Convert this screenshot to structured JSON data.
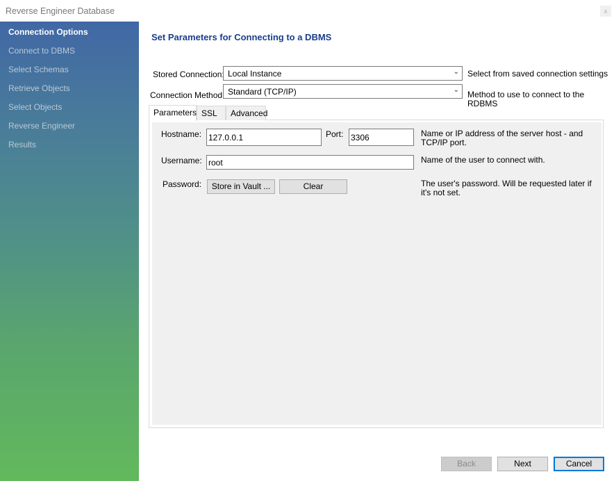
{
  "window": {
    "title": "Reverse Engineer Database",
    "close": "x"
  },
  "sidebar": {
    "items": [
      {
        "label": "Connection Options",
        "active": true
      },
      {
        "label": "Connect to DBMS"
      },
      {
        "label": "Select Schemas"
      },
      {
        "label": "Retrieve Objects"
      },
      {
        "label": "Select Objects"
      },
      {
        "label": "Reverse Engineer"
      },
      {
        "label": "Results"
      }
    ]
  },
  "main": {
    "heading": "Set Parameters for Connecting to a DBMS",
    "stored_connection": {
      "label": "Stored Connection:",
      "value": "Local Instance",
      "desc": "Select from saved connection settings"
    },
    "connection_method": {
      "label": "Connection Method:",
      "value": "Standard (TCP/IP)",
      "desc": "Method to use to connect to the RDBMS"
    },
    "tabs": [
      "Parameters",
      "SSL",
      "Advanced"
    ],
    "params": {
      "hostname_label": "Hostname:",
      "hostname": "127.0.0.1",
      "port_label": "Port:",
      "port": "3306",
      "hostname_desc": "Name or IP address of the server host - and TCP/IP port.",
      "username_label": "Username:",
      "username": "root",
      "username_desc": "Name of the user to connect with.",
      "password_label": "Password:",
      "store_vault": "Store in Vault ...",
      "clear": "Clear",
      "password_desc": "The user's password. Will be requested later if it's not set."
    }
  },
  "footer": {
    "back": "Back",
    "next": "Next",
    "cancel": "Cancel"
  }
}
